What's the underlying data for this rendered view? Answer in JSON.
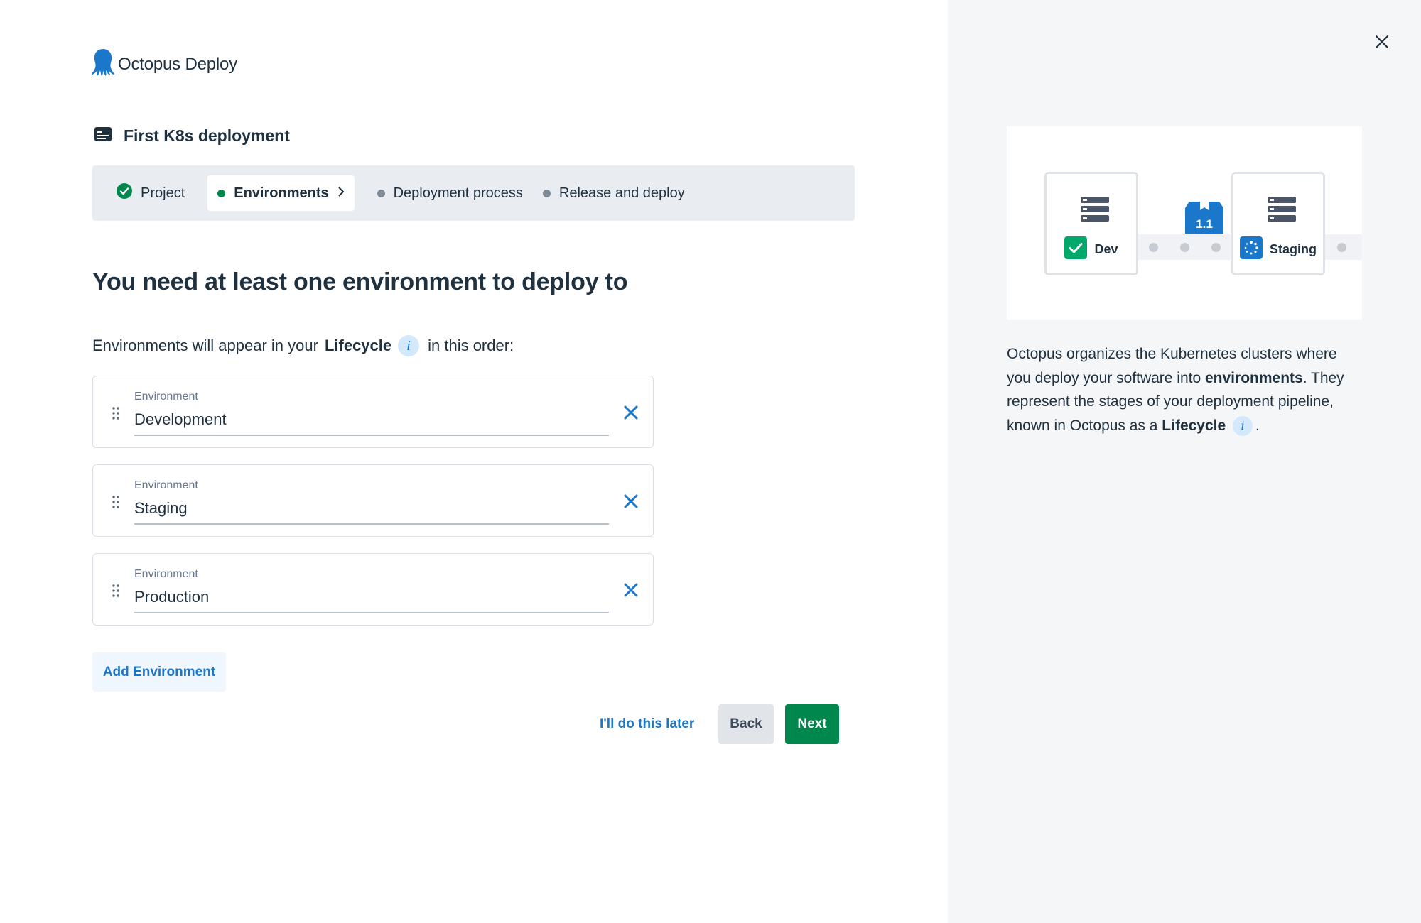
{
  "brand": {
    "name": "Octopus Deploy",
    "color": "#1a77ca"
  },
  "project": {
    "title": "First K8s deployment"
  },
  "stepper": {
    "steps": [
      {
        "label": "Project",
        "state": "complete"
      },
      {
        "label": "Environments",
        "state": "active"
      },
      {
        "label": "Deployment process",
        "state": "pending"
      },
      {
        "label": "Release and deploy",
        "state": "pending"
      }
    ]
  },
  "main": {
    "heading": "You need at least one environment to deploy to",
    "intro_before": "Environments will appear in your",
    "intro_term": "Lifecycle",
    "intro_after": "in this order:",
    "info_glyph": "i",
    "environments": [
      {
        "label": "Environment",
        "value": "Development"
      },
      {
        "label": "Environment",
        "value": "Staging"
      },
      {
        "label": "Environment",
        "value": "Production"
      }
    ],
    "add_label": "Add Environment"
  },
  "footer": {
    "later_label": "I'll do this later",
    "back_label": "Back",
    "next_label": "Next"
  },
  "side": {
    "illustration": {
      "env1": "Dev",
      "env2": "Staging",
      "package_version": "1.1"
    },
    "desc_p1": "Octopus organizes the Kubernetes clusters where you deploy your software into",
    "desc_term1": "environments",
    "desc_p2": ". They represent the stages of your deployment pipeline, known in Octopus as a",
    "desc_term2": "Lifecycle",
    "desc_end": ".",
    "info_glyph": "i"
  },
  "colors": {
    "primary_green": "#00874d",
    "link_blue": "#1a77ca",
    "text": "#1f303f",
    "panel_bg": "#f4f6f8"
  },
  "icons": [
    "octopus-logo-icon",
    "project-card-icon",
    "check-circle-icon",
    "chevron-right-icon",
    "drag-handle-icon",
    "remove-x-icon",
    "close-icon",
    "server-stack-icon",
    "package-icon",
    "spinner-icon",
    "info-icon"
  ]
}
